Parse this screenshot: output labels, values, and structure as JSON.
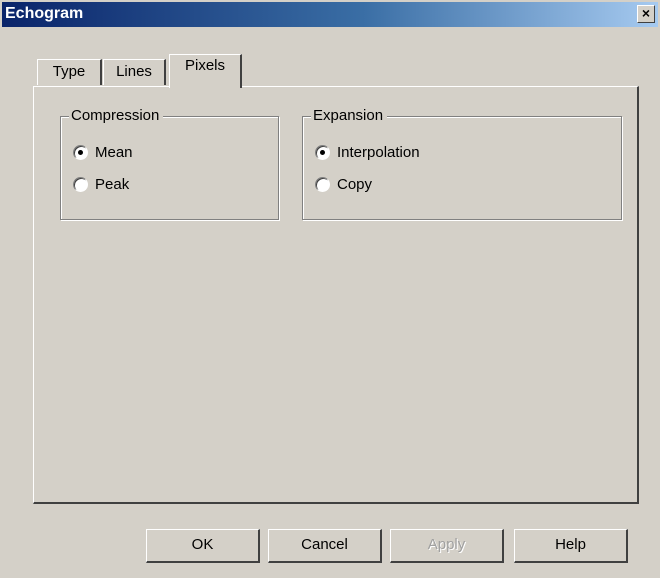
{
  "window": {
    "title": "Echogram",
    "close_glyph": "×"
  },
  "tabs": [
    {
      "label": "Type",
      "active": false
    },
    {
      "label": "Lines",
      "active": false
    },
    {
      "label": "Pixels",
      "active": true
    }
  ],
  "compression": {
    "legend": "Compression",
    "options": [
      {
        "label": "Mean",
        "checked": true
      },
      {
        "label": "Peak",
        "checked": false
      }
    ]
  },
  "expansion": {
    "legend": "Expansion",
    "options": [
      {
        "label": "Interpolation",
        "checked": true
      },
      {
        "label": "Copy",
        "checked": false
      }
    ]
  },
  "buttons": {
    "ok": "OK",
    "cancel": "Cancel",
    "apply": "Apply",
    "help": "Help"
  },
  "colors": {
    "face": "#d4d0c8",
    "title_start": "#0a246a",
    "title_end": "#a6caf0"
  }
}
